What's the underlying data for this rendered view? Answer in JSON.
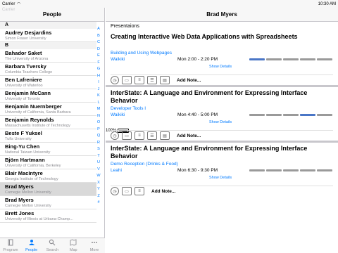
{
  "status": {
    "carrier": "Carrier",
    "time": "10:30 AM",
    "battery": "100%"
  },
  "left": {
    "title": "People",
    "ghost": "Carrier",
    "sections": [
      {
        "letter": "A",
        "people": [
          {
            "name": "Audrey Desjardins",
            "aff": "Simon Fraser University"
          }
        ]
      },
      {
        "letter": "B",
        "people": [
          {
            "name": "Bahador Saket",
            "aff": "The University of Arizona"
          },
          {
            "name": "Barbara Tversky",
            "aff": "Columbia Teachers College"
          },
          {
            "name": "Ben Lafreniere",
            "aff": "University of Waterloo"
          },
          {
            "name": "Benjamin McCann",
            "aff": "University of Toronto"
          },
          {
            "name": "Benjamin Nuernberger",
            "aff": "University of California, Santa Barbara"
          },
          {
            "name": "Benjamin Reynolds",
            "aff": "Massachusetts Institute of Technology"
          },
          {
            "name": "Beste F Yuksel",
            "aff": "Tufts University"
          },
          {
            "name": "Bing-Yu Chen",
            "aff": "National Taiwan University"
          },
          {
            "name": "Björn Hartmann",
            "aff": "University of California, Berkeley"
          },
          {
            "name": "Blair MacIntyre",
            "aff": "Georgia Institute of Technology"
          },
          {
            "name": "Brad Myers",
            "aff": "Carnegie Mellon University",
            "selected": true
          },
          {
            "name": "Brad Myers",
            "aff": "Carnegie Mellon University"
          },
          {
            "name": "Brett Jones",
            "aff": "University of Illinois at Urbana-Champ..."
          }
        ]
      }
    ],
    "index": [
      "A",
      "B",
      "C",
      "D",
      "E",
      "F",
      "G",
      "H",
      "I",
      "J",
      "K",
      "L",
      "M",
      "N",
      "O",
      "P",
      "Q",
      "R",
      "S",
      "T",
      "U",
      "V",
      "W",
      "X",
      "Y",
      "Z",
      "#"
    ]
  },
  "tabs": [
    {
      "label": "Program",
      "icon": "book-icon"
    },
    {
      "label": "People",
      "icon": "person-icon",
      "active": true
    },
    {
      "label": "Search",
      "icon": "search-icon"
    },
    {
      "label": "Map",
      "icon": "map-icon"
    },
    {
      "label": "More",
      "icon": "more-icon"
    }
  ],
  "right": {
    "title": "Brad Myers",
    "subtitle": "Presentaions",
    "cards": [
      {
        "title": "Creating Interactive Web Data Applications with Spreadsheets",
        "session": "Building and Using Webpages",
        "location": "Waikiki",
        "time": "Mon 2:00 - 2:20 PM",
        "active_bar": 0,
        "show": "Show Details",
        "add_note": "Add Note..."
      },
      {
        "title": "InterState: A Language and Environment for Expressing Interface Behavior",
        "session": "Developer Tools I",
        "location": "Waikiki",
        "time": "Mon 4:40 - 5:00 PM",
        "active_bar": 3,
        "show": "Show Details",
        "add_note": "Add Note..."
      },
      {
        "title": "InterState: A Language and Environment for Expressing Interface Behavior",
        "session": "Demo Reception (Drinks & Food)",
        "location": "Leahi",
        "time": "Mon 6:30 - 9:30 PM",
        "active_bar": -1,
        "show": "Show Details",
        "add_note": "Add Note..."
      }
    ]
  },
  "colors": {
    "accent": "#007aff",
    "bar_active": "#4a76c6",
    "bar_inactive": "#9a9a9a"
  }
}
